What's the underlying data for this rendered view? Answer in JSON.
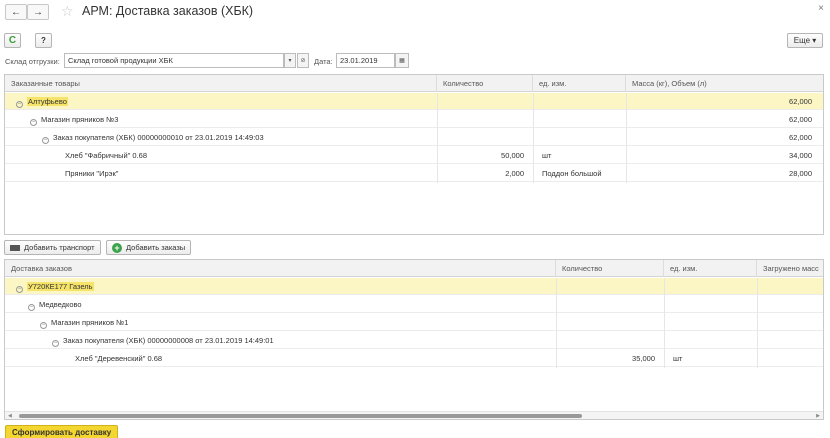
{
  "window": {
    "title": "АРМ: Доставка заказов (ХБК)",
    "back_icon": "←",
    "forward_icon": "→",
    "star_icon": "☆",
    "close_icon": "×"
  },
  "toolbar": {
    "refresh_icon": "C",
    "help_label": "?",
    "more_label": "Еще ▾"
  },
  "filters": {
    "warehouse_label": "Склад отгрузки:",
    "warehouse_value": "Склад готовой продукции ХБК",
    "date_label": "Дата:",
    "date_value": "23.01.2019"
  },
  "ordered_goods": {
    "columns": [
      "Заказанные товары",
      "Количество",
      "ед. изм.",
      "Масса (кг), Объем (л)"
    ],
    "rows": [
      {
        "name": "Алтуфьево",
        "qty": "",
        "unit": "",
        "mass": "62,000"
      },
      {
        "name": "Магазин пряников №3",
        "qty": "",
        "unit": "",
        "mass": "62,000"
      },
      {
        "name": "Заказ покупателя (ХБК) 00000000010 от 23.01.2019 14:49:03",
        "qty": "",
        "unit": "",
        "mass": "62,000"
      },
      {
        "name": "Хлеб \"Фабричный\" 0.68",
        "qty": "50,000",
        "unit": "шт",
        "mass": "34,000"
      },
      {
        "name": "Пряники \"Ирэк\"",
        "qty": "2,000",
        "unit": "Поддон большой",
        "mass": "28,000"
      }
    ]
  },
  "actions": {
    "add_transport": "Добавить транспорт",
    "add_orders": "Добавить заказы"
  },
  "delivery": {
    "columns": [
      "Доставка заказов",
      "Количество",
      "ед. изм.",
      "Загружено масс"
    ],
    "rows": [
      {
        "name": "У720КЕ177 Газель",
        "qty": "",
        "unit": ""
      },
      {
        "name": "Медведково",
        "qty": "",
        "unit": ""
      },
      {
        "name": "Магазин пряников №1",
        "qty": "",
        "unit": ""
      },
      {
        "name": "Заказ покупателя (ХБК) 00000000008 от 23.01.2019 14:49:01",
        "qty": "",
        "unit": ""
      },
      {
        "name": "Хлеб \"Деревенский\" 0.68",
        "qty": "35,000",
        "unit": "шт"
      }
    ]
  },
  "primary_button": "Сформировать доставку"
}
